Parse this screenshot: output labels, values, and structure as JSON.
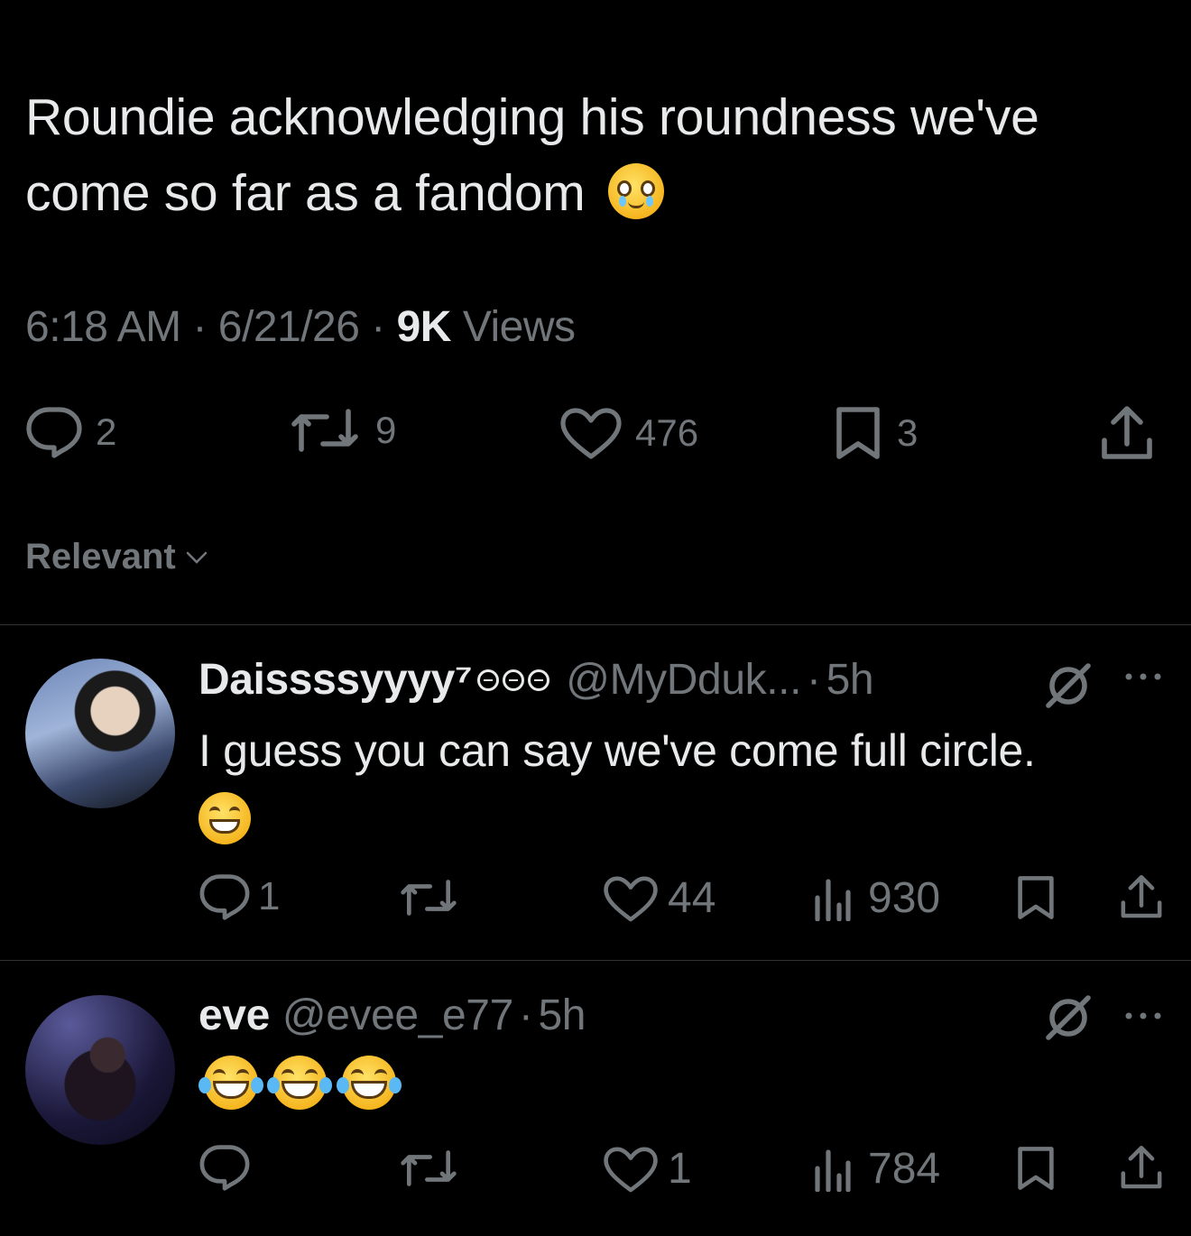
{
  "tweet": {
    "text": "Roundie acknowledging his roundness we've come so far as a fandom",
    "emoji": "pleading-face-with-tears",
    "time": "6:18 AM",
    "date": "6/21/26",
    "views_count": "9K",
    "views_label": "Views",
    "separator": "·",
    "replies": "2",
    "reposts": "9",
    "likes": "476",
    "bookmarks": "3"
  },
  "sort": {
    "label": "Relevant"
  },
  "replies": [
    {
      "name": "Daissssyyyy⁷",
      "handle": "@MyDduk...",
      "time": "5h",
      "text": "I guess you can say we've come full circle.",
      "emoji": "grinning-face",
      "replies": "1",
      "reposts": "",
      "likes": "44",
      "views": "930"
    },
    {
      "name": "eve",
      "handle": "@evee_e77",
      "time": "5h",
      "text": "",
      "emoji": "face-with-tears-of-joy x3",
      "replies": "",
      "reposts": "",
      "likes": "1",
      "views": "784"
    }
  ],
  "colors": {
    "background": "#000000",
    "text": "#e7e9ea",
    "muted": "#71767b",
    "divider": "#2f3336"
  }
}
